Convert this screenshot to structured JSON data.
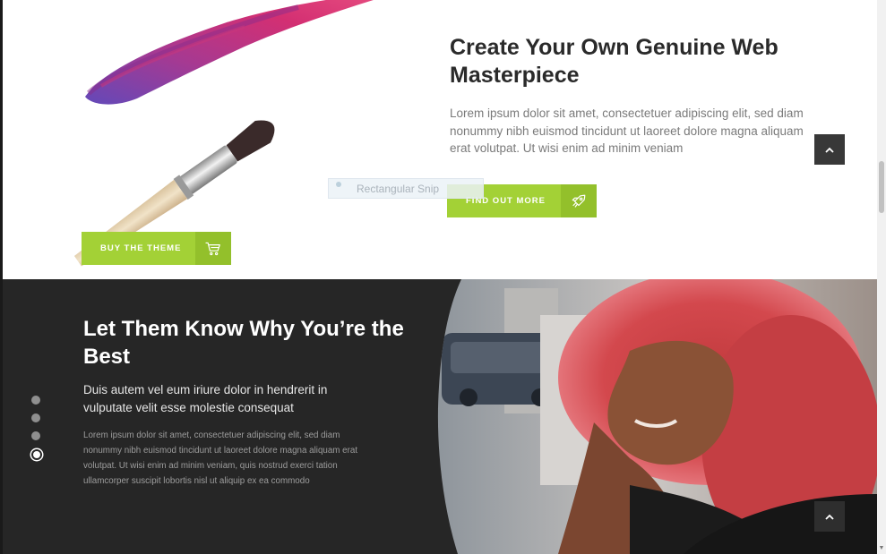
{
  "hero": {
    "title": "Create Your Own Genuine Web Masterpiece",
    "body": "Lorem ipsum dolor sit amet, consectetuer adipiscing elit, sed diam nonummy nibh euismod tincidunt ut laoreet dolore magna aliquam erat volutpat. Ut wisi enim ad minim veniam",
    "cta_label": "FIND OUT MORE",
    "cta_icon": "rocket-icon",
    "art_icon": "paintbrush-stroke"
  },
  "snip_overlay": {
    "label": "Rectangular Snip"
  },
  "feature": {
    "title": "Let Them Know Why You’re the Best",
    "subtitle": "Duis autem vel eum iriure dolor in hendrerit in vulputate velit esse molestie consequat",
    "body": "Lorem ipsum dolor sit amet, consectetuer adipiscing elit, sed diam nonummy nibh euismod tincidunt ut laoreet dolore magna aliquam erat volutpat. Ut wisi enim ad minim veniam, quis nostrud exerci tation ullamcorper suscipit lobortis nisl ut aliquip ex ea commodo",
    "cta_label": "BUY THE THEME",
    "cta_icon": "cart-icon",
    "slider": {
      "count": 4,
      "active_index": 3
    }
  },
  "colors": {
    "accent": "#a3d136",
    "accent_dark": "#93c02b",
    "dark_bg": "#262626",
    "heading": "#2a2a2a",
    "body_text": "#7a7a7a"
  },
  "controls": {
    "scroll_top_icon": "chevron-up-icon"
  }
}
